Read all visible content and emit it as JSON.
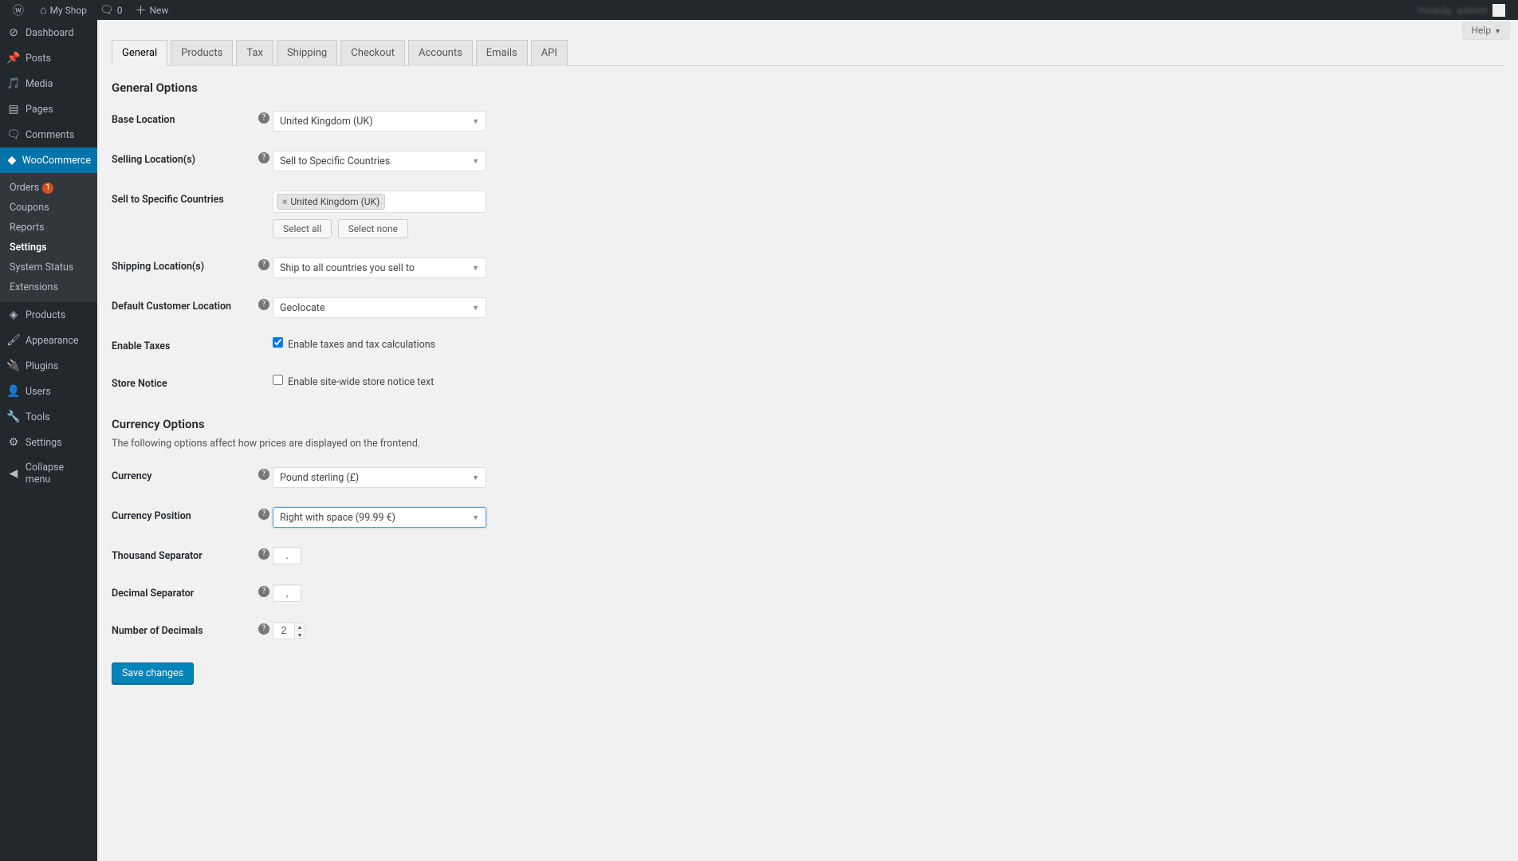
{
  "adminbar": {
    "site_name": "My Shop",
    "comments_count": "0",
    "new_label": "New",
    "user_greeting": "Howdy, admin"
  },
  "sidebar": {
    "dashboard": "Dashboard",
    "posts": "Posts",
    "media": "Media",
    "pages": "Pages",
    "comments": "Comments",
    "woocommerce": "WooCommerce",
    "sub": {
      "orders": "Orders",
      "orders_badge": "1",
      "coupons": "Coupons",
      "reports": "Reports",
      "settings": "Settings",
      "system_status": "System Status",
      "extensions": "Extensions"
    },
    "products": "Products",
    "appearance": "Appearance",
    "plugins": "Plugins",
    "users": "Users",
    "tools": "Tools",
    "settings": "Settings",
    "collapse": "Collapse menu"
  },
  "help_label": "Help",
  "tabs": {
    "general": "General",
    "products": "Products",
    "tax": "Tax",
    "shipping": "Shipping",
    "checkout": "Checkout",
    "accounts": "Accounts",
    "emails": "Emails",
    "api": "API"
  },
  "sections": {
    "general": "General Options",
    "currency": "Currency Options",
    "currency_desc": "The following options affect how prices are displayed on the frontend."
  },
  "fields": {
    "base_location": {
      "label": "Base Location",
      "value": "United Kingdom (UK)"
    },
    "selling_locations": {
      "label": "Selling Location(s)",
      "value": "Sell to Specific Countries"
    },
    "sell_to_specific": {
      "label": "Sell to Specific Countries",
      "tag": "United Kingdom (UK)",
      "select_all": "Select all",
      "select_none": "Select none"
    },
    "shipping_locations": {
      "label": "Shipping Location(s)",
      "value": "Ship to all countries you sell to"
    },
    "default_customer_location": {
      "label": "Default Customer Location",
      "value": "Geolocate"
    },
    "enable_taxes": {
      "label": "Enable Taxes",
      "checkbox_label": "Enable taxes and tax calculations",
      "checked": true
    },
    "store_notice": {
      "label": "Store Notice",
      "checkbox_label": "Enable site-wide store notice text",
      "checked": false
    },
    "currency": {
      "label": "Currency",
      "value": "Pound sterling (£)"
    },
    "currency_position": {
      "label": "Currency Position",
      "value": "Right with space (99.99 €)"
    },
    "thousand_sep": {
      "label": "Thousand Separator",
      "value": "."
    },
    "decimal_sep": {
      "label": "Decimal Separator",
      "value": ","
    },
    "num_decimals": {
      "label": "Number of Decimals",
      "value": "2"
    }
  },
  "save_button": "Save changes"
}
